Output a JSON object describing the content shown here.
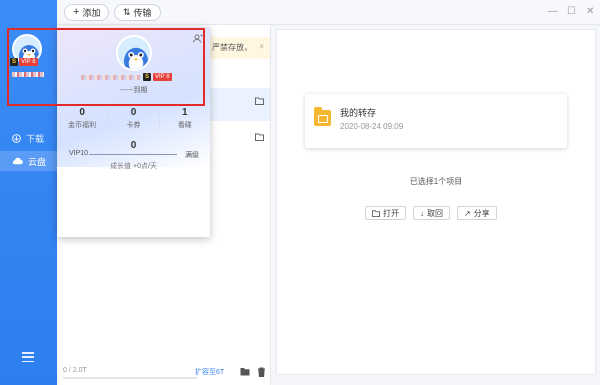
{
  "toolbar": {
    "add_label": "添加",
    "transfer_label": "传输"
  },
  "sidebar": {
    "items": [
      {
        "label": "下载",
        "icon": "download-icon"
      },
      {
        "label": "云盘",
        "icon": "cloud-icon",
        "active": true
      }
    ],
    "vip_badge": "VIP 8"
  },
  "list_panel": {
    "notice_text": "严禁存放，",
    "quota_text": "0 / 2.0T",
    "expand_label": "扩容至6T"
  },
  "popup": {
    "vip_badge": "VIP 8",
    "expire_text": "------到期",
    "stats": [
      {
        "value": "0",
        "label": "金币福利"
      },
      {
        "value": "0",
        "label": "卡券"
      },
      {
        "value": "1",
        "label": "看碟"
      }
    ],
    "growth_value": "0",
    "growth_left": "VIP10",
    "growth_right": "满级",
    "growth_sub": "成长值 +0点/天"
  },
  "detail": {
    "folder_name": "我的转存",
    "folder_date": "2020-08-24 09:09",
    "selected_text": "已选择1个项目",
    "actions": [
      {
        "label": "打开",
        "icon": "open-folder-icon"
      },
      {
        "label": "取回",
        "icon": "download-arrow-icon"
      },
      {
        "label": "分享",
        "icon": "share-icon"
      }
    ]
  },
  "colors": {
    "sidebar": "#3b8cf6",
    "highlight": "#e12b2b",
    "folder": "#f5b731",
    "link": "#3b86f2"
  }
}
